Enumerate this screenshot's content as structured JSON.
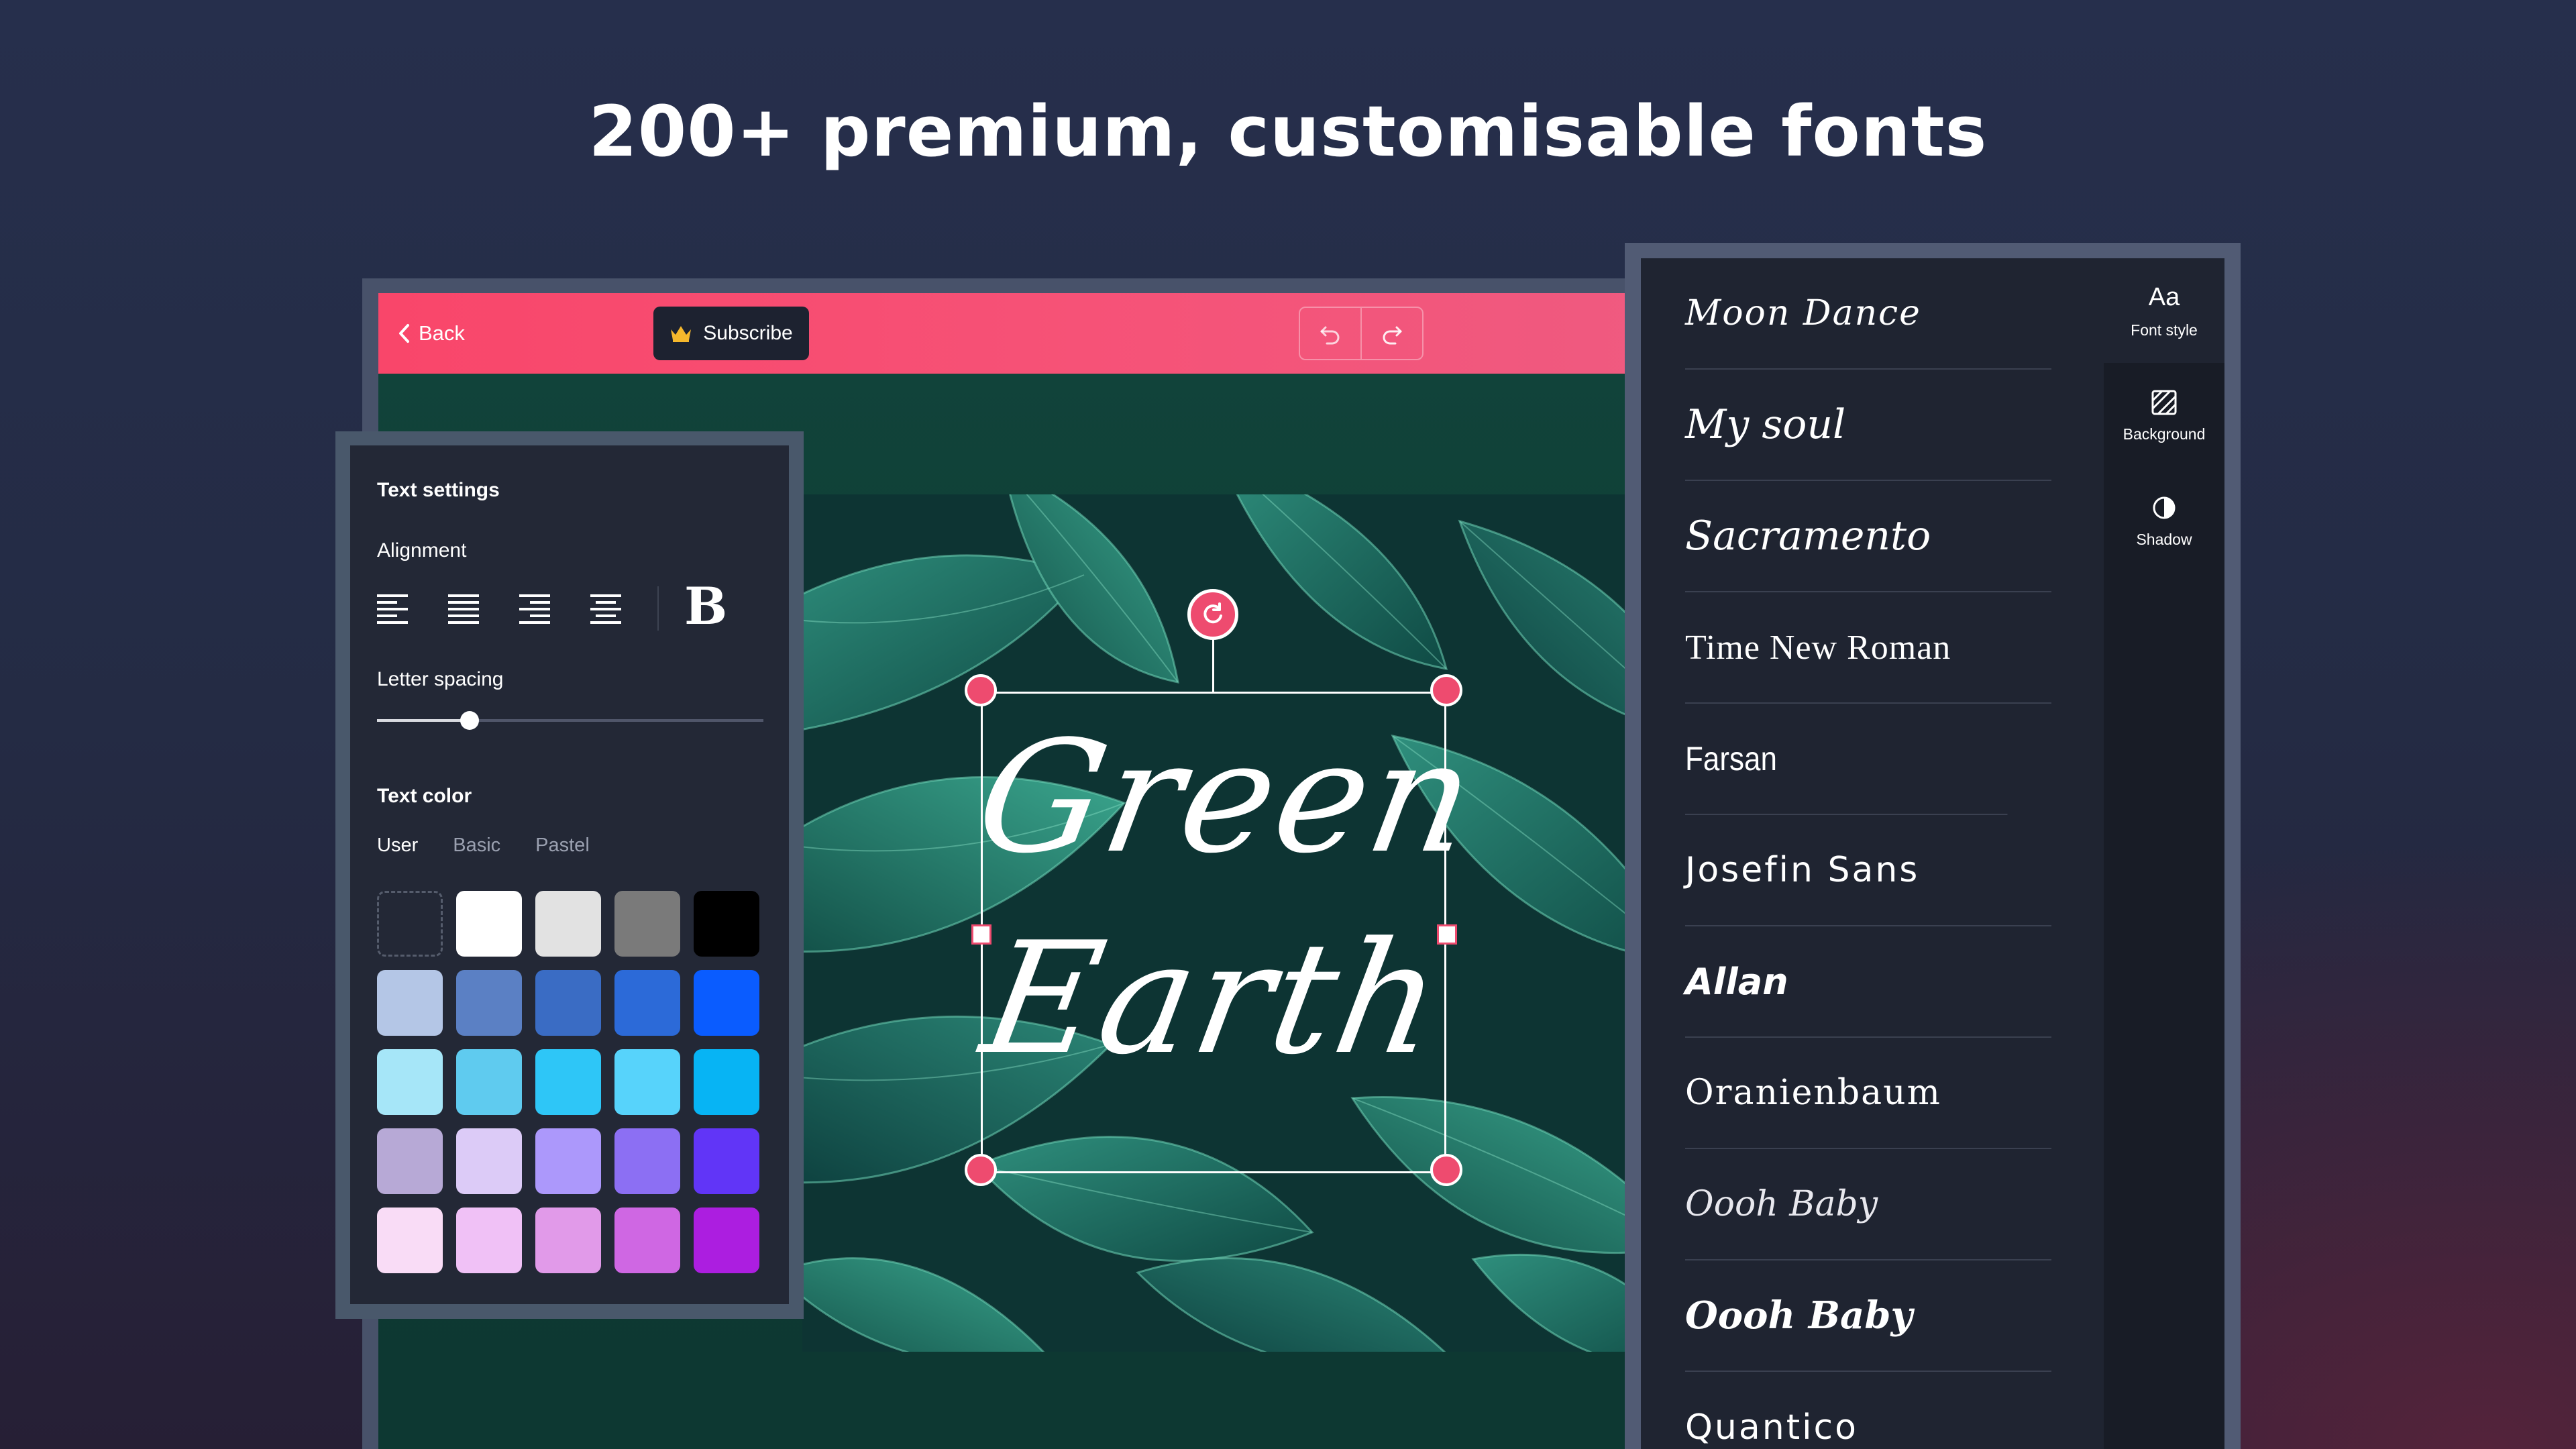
{
  "headline": "200+ premium, customisable fonts",
  "toolbar": {
    "back_label": "Back",
    "subscribe_label": "Subscribe"
  },
  "canvas": {
    "line1": "Green",
    "line2": "Earth"
  },
  "text_settings": {
    "title": "Text settings",
    "alignment_label": "Alignment",
    "bold_label": "B",
    "letter_spacing_label": "Letter spacing",
    "letter_spacing_level": 0.24,
    "text_color_label": "Text color",
    "tabs": [
      "User",
      "Basic",
      "Pastel"
    ],
    "swatches": [
      [
        "",
        "#ffffff",
        "#e2e2e2",
        "#7a7a7a",
        "#000000"
      ],
      [
        "#b4c6e6",
        "#5b80c4",
        "#3a6cc4",
        "#2c6ad8",
        "#0a5cff"
      ],
      [
        "#a6e6f8",
        "#5fcbef",
        "#2ec6f7",
        "#57d3fb",
        "#07b4f4"
      ],
      [
        "#b7a9d6",
        "#dccbf7",
        "#ac98fb",
        "#8c6ff3",
        "#6135f7"
      ],
      [
        "#f9dcf6",
        "#f0c1f6",
        "#e19ae9",
        "#cf67e3",
        "#ac1ee0"
      ]
    ]
  },
  "font_list": {
    "fonts": [
      "Moon Dance",
      "My soul",
      "Sacramento",
      "Time New Roman",
      "Farsan",
      "Josefin Sans",
      "Allan",
      "Oranienbaum",
      "Oooh Baby",
      "Oooh Baby",
      "Quantico"
    ]
  },
  "side_menu": {
    "font_style": {
      "icon": "Aa",
      "label": "Font style"
    },
    "background": {
      "label": "Background"
    },
    "shadow": {
      "label": "Shadow"
    }
  },
  "colors": {
    "accent": "#f9466a",
    "panel": "#232836",
    "handle": "#ee4b6f"
  }
}
